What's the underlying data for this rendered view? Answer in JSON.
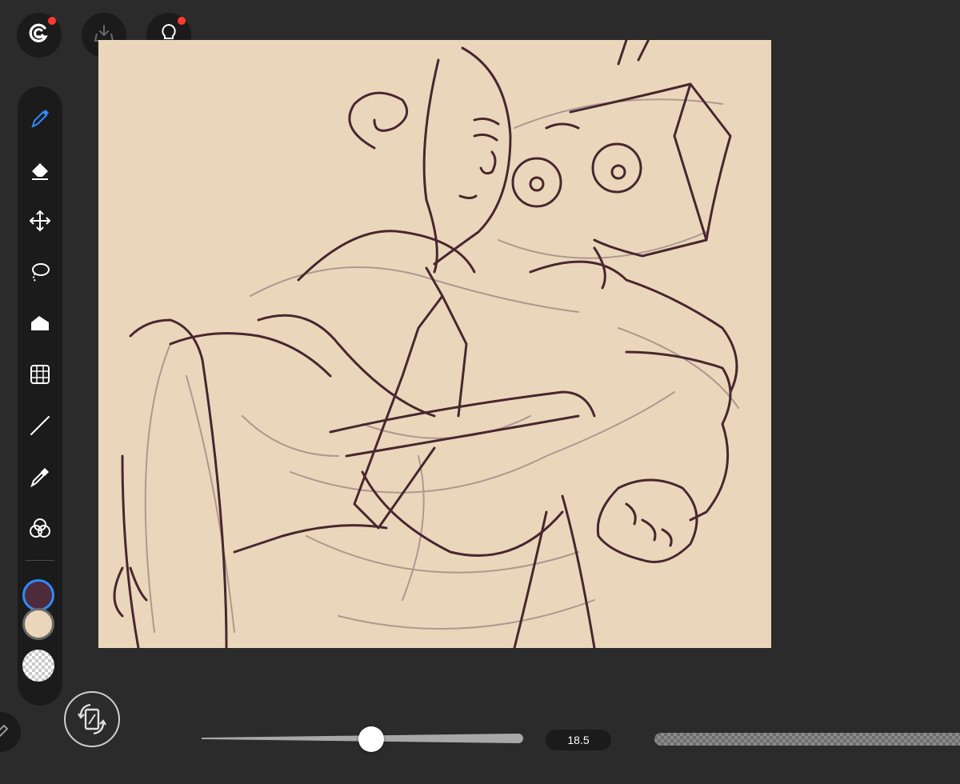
{
  "top_bar": {
    "buttons": [
      {
        "icon": "gallery-swirl-icon",
        "badge": true
      },
      {
        "icon": "download-tray-icon",
        "badge": false
      },
      {
        "icon": "lightbulb-icon",
        "badge": true
      }
    ]
  },
  "toolbar": {
    "tools": [
      {
        "name": "pen",
        "icon": "pen-icon",
        "active": true
      },
      {
        "name": "eraser",
        "icon": "eraser-icon",
        "active": false
      },
      {
        "name": "move",
        "icon": "move-arrows-icon",
        "active": false
      },
      {
        "name": "lasso",
        "icon": "lasso-icon",
        "active": false
      },
      {
        "name": "fill",
        "icon": "paint-bucket-icon",
        "active": false
      },
      {
        "name": "transform",
        "icon": "grid-transform-icon",
        "active": false
      },
      {
        "name": "line",
        "icon": "line-icon",
        "active": false
      },
      {
        "name": "eyedropper",
        "icon": "eyedropper-icon",
        "active": false
      },
      {
        "name": "color-blend",
        "icon": "color-circles-icon",
        "active": false
      }
    ],
    "colors": {
      "primary": "#4e2b3a",
      "secondary": "#ead7bb",
      "transparent": "checker"
    },
    "active_color": "#2e8bff"
  },
  "canvas": {
    "background": "#ead7bb",
    "line_color": "#4a2630",
    "sketch_color": "#a58d89"
  },
  "bottom_bar": {
    "brush_size": "18.5",
    "brush_size_slider_fraction": 0.5
  }
}
